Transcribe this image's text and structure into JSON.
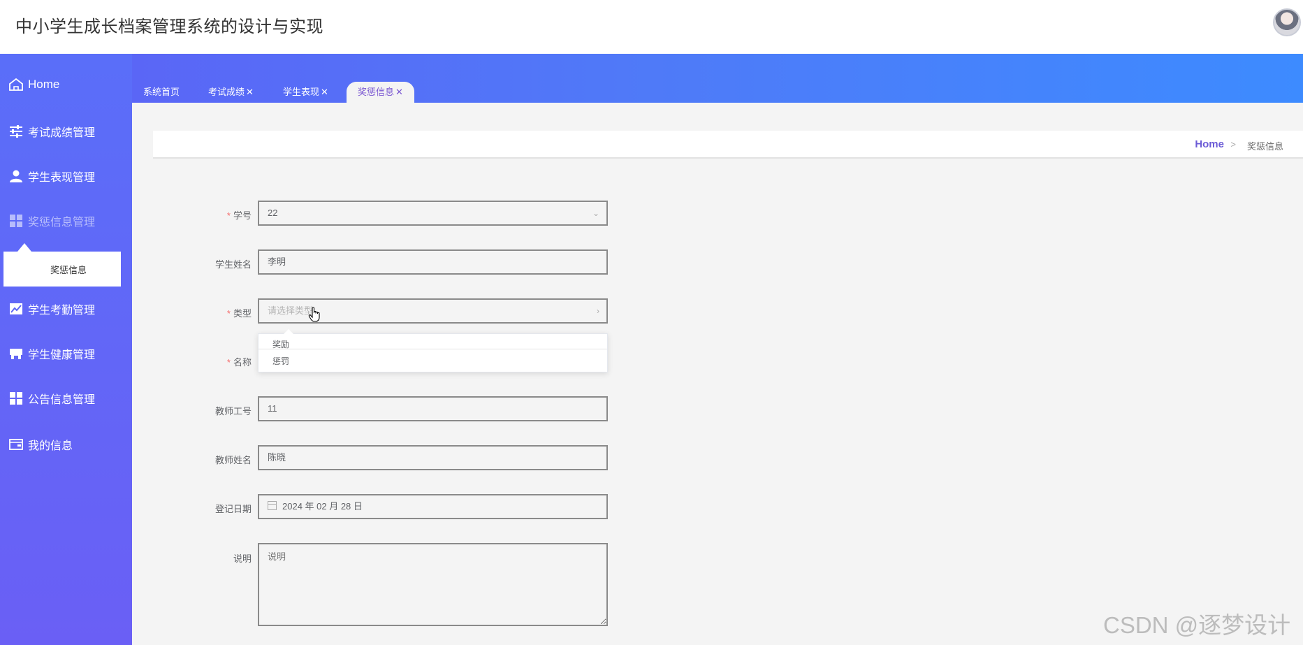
{
  "header": {
    "title": "中小学生成长档案管理系统的设计与实现"
  },
  "sidebar": {
    "home": "Home",
    "items": [
      {
        "label": "考试成绩管理",
        "icon": "sliders-icon"
      },
      {
        "label": "学生表现管理",
        "icon": "user-icon"
      },
      {
        "label": "奖惩信息管理",
        "icon": "grid-icon"
      },
      {
        "label": "学生考勤管理",
        "icon": "chart-icon"
      },
      {
        "label": "学生健康管理",
        "icon": "shop-icon"
      },
      {
        "label": "公告信息管理",
        "icon": "grid-icon"
      },
      {
        "label": "我的信息",
        "icon": "wallet-icon"
      }
    ],
    "submenu": {
      "label": "奖惩信息"
    }
  },
  "tabs": [
    {
      "label": "系统首页",
      "closable": false
    },
    {
      "label": "考试成绩",
      "closable": true
    },
    {
      "label": "学生表现",
      "closable": true
    },
    {
      "label": "奖惩信息",
      "closable": true,
      "active": true
    }
  ],
  "close_glyph": "✕",
  "breadcrumb": {
    "home": "Home",
    "separator": ">",
    "current": "奖惩信息"
  },
  "form": {
    "student_id": {
      "label": "学号",
      "value": "22",
      "required": "*"
    },
    "student_name": {
      "label": "学生姓名",
      "value": "李明"
    },
    "type": {
      "label": "类型",
      "placeholder": "请选择类型",
      "required": "*",
      "options": [
        "奖励",
        "惩罚"
      ]
    },
    "name": {
      "label": "名称",
      "required": "*"
    },
    "teacher_id": {
      "label": "教师工号",
      "value": "11"
    },
    "teacher_name": {
      "label": "教师姓名",
      "value": "陈晓"
    },
    "date": {
      "label": "登记日期",
      "value": "2024 年 02 月 28 日"
    },
    "description": {
      "label": "说明",
      "placeholder": "说明"
    }
  },
  "watermark": "CSDN @逐梦设计",
  "colors": {
    "accent": "#6b5bd6",
    "band_start": "#5d61f6",
    "band_end": "#3d8bff",
    "required": "#f56c6c"
  }
}
